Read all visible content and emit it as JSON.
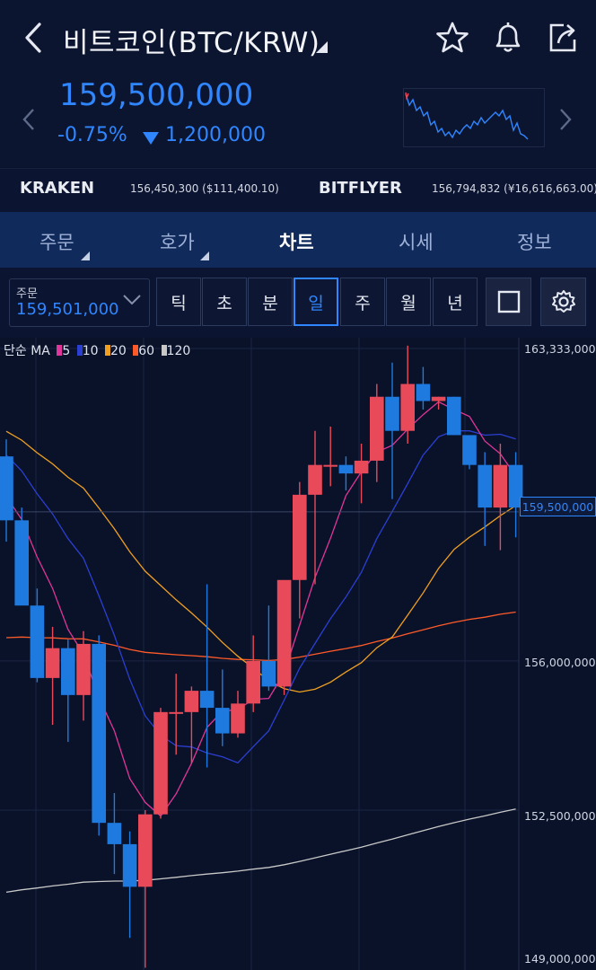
{
  "header": {
    "title": "비트코인(BTC/KRW)",
    "icons": [
      "back-icon",
      "star-icon",
      "bell-icon",
      "share-icon"
    ]
  },
  "price": {
    "current": "159,500,000",
    "change_percent": "-0.75%",
    "change_amount": "1,200,000",
    "color": "#2f86ff"
  },
  "exchanges": [
    {
      "name": "KRAKEN",
      "value": "156,450,300 ($111,400.10)"
    },
    {
      "name": "BITFLYER",
      "value": "156,794,832 (¥16,616,663.00)"
    }
  ],
  "tabs": [
    {
      "label": "주문",
      "active": false
    },
    {
      "label": "호가",
      "active": false
    },
    {
      "label": "차트",
      "active": true
    },
    {
      "label": "시세",
      "active": false
    },
    {
      "label": "정보",
      "active": false
    }
  ],
  "toolbar": {
    "order_label": "주문",
    "order_value": "159,501,000",
    "periods": [
      "틱",
      "초",
      "분",
      "일",
      "주",
      "월",
      "년"
    ],
    "selected_period": "일"
  },
  "chart_legend": {
    "prefix": "단순 MA",
    "items": [
      {
        "label": "5",
        "color": "#e0359a"
      },
      {
        "label": "10",
        "color": "#2b3fd0"
      },
      {
        "label": "20",
        "color": "#f0a020"
      },
      {
        "label": "60",
        "color": "#ff5a2a"
      },
      {
        "label": "120",
        "color": "#c8c8c8"
      }
    ]
  },
  "chart_data": {
    "type": "candlestick",
    "y_axis_labels": [
      "163,333,000",
      "156,000,000",
      "152,500,000",
      "149,000,000"
    ],
    "current_price_label": "159,500,000",
    "up_color": "#e84a5a",
    "down_color": "#1f7ae0",
    "ylim": [
      149000000,
      163333000
    ],
    "candles": [
      {
        "o": 160800000,
        "h": 161200000,
        "l": 158800000,
        "c": 159300000
      },
      {
        "o": 159300000,
        "h": 159600000,
        "l": 157400000,
        "c": 157300000
      },
      {
        "o": 157300000,
        "h": 157700000,
        "l": 155500000,
        "c": 155600000
      },
      {
        "o": 155600000,
        "h": 156800000,
        "l": 154500000,
        "c": 156300000
      },
      {
        "o": 156300000,
        "h": 156500000,
        "l": 154100000,
        "c": 155200000
      },
      {
        "o": 155200000,
        "h": 156700000,
        "l": 154600000,
        "c": 156400000
      },
      {
        "o": 156400000,
        "h": 156600000,
        "l": 151900000,
        "c": 152200000
      },
      {
        "o": 152200000,
        "h": 152900000,
        "l": 151000000,
        "c": 151700000
      },
      {
        "o": 151700000,
        "h": 152000000,
        "l": 149500000,
        "c": 150700000
      },
      {
        "o": 150700000,
        "h": 152500000,
        "l": 148800000,
        "c": 152400000
      },
      {
        "o": 152400000,
        "h": 154900000,
        "l": 152300000,
        "c": 154800000
      },
      {
        "o": 154800000,
        "h": 155700000,
        "l": 153800000,
        "c": 154800000
      },
      {
        "o": 154800000,
        "h": 155400000,
        "l": 153600000,
        "c": 155300000
      },
      {
        "o": 155300000,
        "h": 157800000,
        "l": 153500000,
        "c": 154900000
      },
      {
        "o": 154900000,
        "h": 155800000,
        "l": 154000000,
        "c": 154300000
      },
      {
        "o": 154300000,
        "h": 155300000,
        "l": 154200000,
        "c": 155000000
      },
      {
        "o": 155000000,
        "h": 156600000,
        "l": 154800000,
        "c": 156000000
      },
      {
        "o": 156000000,
        "h": 157300000,
        "l": 155300000,
        "c": 155400000
      },
      {
        "o": 155400000,
        "h": 157700000,
        "l": 155200000,
        "c": 157900000
      },
      {
        "o": 157900000,
        "h": 160200000,
        "l": 157000000,
        "c": 159900000
      },
      {
        "o": 159900000,
        "h": 161400000,
        "l": 157800000,
        "c": 160600000
      },
      {
        "o": 160600000,
        "h": 161500000,
        "l": 160100000,
        "c": 160600000
      },
      {
        "o": 160600000,
        "h": 160800000,
        "l": 160000000,
        "c": 160400000
      },
      {
        "o": 160400000,
        "h": 161100000,
        "l": 159700000,
        "c": 160700000
      },
      {
        "o": 160700000,
        "h": 162500000,
        "l": 160200000,
        "c": 162200000
      },
      {
        "o": 162200000,
        "h": 163000000,
        "l": 159800000,
        "c": 161400000
      },
      {
        "o": 161400000,
        "h": 163400000,
        "l": 161100000,
        "c": 162500000
      },
      {
        "o": 162500000,
        "h": 162900000,
        "l": 161900000,
        "c": 162100000
      },
      {
        "o": 162100000,
        "h": 162200000,
        "l": 161900000,
        "c": 162200000
      },
      {
        "o": 162200000,
        "h": 162200000,
        "l": 161300000,
        "c": 161300000
      },
      {
        "o": 161300000,
        "h": 161300000,
        "l": 160500000,
        "c": 160600000
      },
      {
        "o": 160600000,
        "h": 160900000,
        "l": 158700000,
        "c": 159600000
      },
      {
        "o": 159600000,
        "h": 161100000,
        "l": 158600000,
        "c": 160600000
      },
      {
        "o": 160600000,
        "h": 160900000,
        "l": 158900000,
        "c": 159600000
      }
    ]
  }
}
